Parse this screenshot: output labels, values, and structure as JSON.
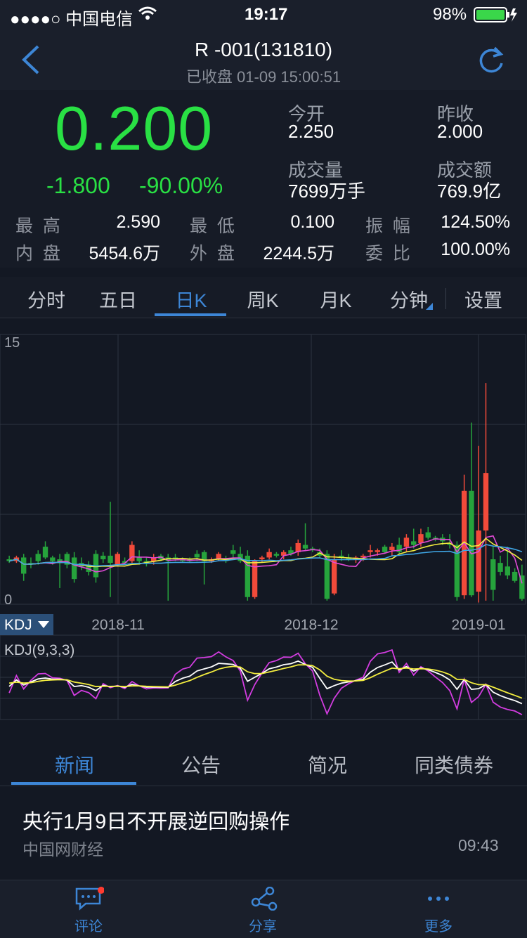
{
  "status_bar": {
    "carrier": "●●●●○ 中国电信",
    "time": "19:17",
    "battery": "98%"
  },
  "header": {
    "title": "R -001(131810)",
    "subtitle": "已收盘   01-09 15:00:51"
  },
  "quote": {
    "price": "0.200",
    "change": "-1.800",
    "change_pct": "-90.00%",
    "open_label": "今开",
    "open": "2.250",
    "prev_close_label": "昨收",
    "prev_close": "2.000",
    "volume_label": "成交量",
    "volume": "7699万手",
    "amount_label": "成交额",
    "amount": "769.9亿",
    "grid": [
      {
        "label": "最  高",
        "value": "2.590"
      },
      {
        "label": "最  低",
        "value": "0.100"
      },
      {
        "label": "振  幅",
        "value": "124.50%"
      },
      {
        "label": "内  盘",
        "value": "5454.6万"
      },
      {
        "label": "外  盘",
        "value": "2244.5万"
      },
      {
        "label": "委  比",
        "value": "100.00%"
      }
    ]
  },
  "chart_tabs": [
    "分时",
    "五日",
    "日K",
    "周K",
    "月K",
    "分钟",
    "设置"
  ],
  "active_chart_tab": "日K",
  "kline": {
    "y_top": "15",
    "y_bottom": "0",
    "x_labels": [
      "2018-11",
      "2018-12",
      "2019-01"
    ],
    "indicator_button": "KDJ",
    "indicator_params": "KDJ(9,3,3)"
  },
  "colors": {
    "up": "#f24a3a",
    "down": "#26a33c",
    "price_green": "#29e044",
    "accent": "#3d86d6"
  },
  "chart_data": {
    "type": "candlestick",
    "ylim": [
      0,
      15
    ],
    "x_ticks": [
      "2018-11",
      "2018-12",
      "2019-01"
    ],
    "candles": [
      {
        "o": 2.5,
        "h": 2.7,
        "l": 2.3,
        "c": 2.4
      },
      {
        "o": 2.4,
        "h": 2.7,
        "l": 2.3,
        "c": 2.6
      },
      {
        "o": 2.6,
        "h": 2.8,
        "l": 1.3,
        "c": 1.7
      },
      {
        "o": 2.3,
        "h": 2.6,
        "l": 2.0,
        "c": 2.2
      },
      {
        "o": 2.8,
        "h": 3.0,
        "l": 2.2,
        "c": 2.4
      },
      {
        "o": 3.2,
        "h": 3.5,
        "l": 2.5,
        "c": 2.6
      },
      {
        "o": 2.6,
        "h": 2.7,
        "l": 2.2,
        "c": 2.4
      },
      {
        "o": 2.5,
        "h": 2.8,
        "l": 0.9,
        "c": 2.3
      },
      {
        "o": 2.8,
        "h": 2.9,
        "l": 2.0,
        "c": 2.2
      },
      {
        "o": 2.6,
        "h": 2.9,
        "l": 1.2,
        "c": 1.4
      },
      {
        "o": 2.3,
        "h": 2.6,
        "l": 1.9,
        "c": 2.1
      },
      {
        "o": 2.2,
        "h": 2.4,
        "l": 1.6,
        "c": 1.8
      },
      {
        "o": 2.8,
        "h": 3.0,
        "l": 1.2,
        "c": 1.5
      },
      {
        "o": 2.7,
        "h": 2.9,
        "l": 2.3,
        "c": 2.5
      },
      {
        "o": 2.7,
        "h": 5.7,
        "l": 0.4,
        "c": 2.3
      },
      {
        "o": 2.2,
        "h": 2.9,
        "l": 2.1,
        "c": 2.8
      },
      {
        "o": 2.4,
        "h": 2.6,
        "l": 2.2,
        "c": 2.3
      },
      {
        "o": 2.4,
        "h": 3.5,
        "l": 2.3,
        "c": 3.3
      },
      {
        "o": 2.6,
        "h": 3.0,
        "l": 2.2,
        "c": 2.4
      },
      {
        "o": 2.4,
        "h": 2.6,
        "l": 2.1,
        "c": 2.3
      },
      {
        "o": 2.4,
        "h": 2.8,
        "l": 2.2,
        "c": 2.6
      },
      {
        "o": 2.7,
        "h": 2.8,
        "l": 2.4,
        "c": 2.5
      },
      {
        "o": 2.6,
        "h": 2.8,
        "l": 0.2,
        "c": 2.4
      },
      {
        "o": 2.6,
        "h": 2.8,
        "l": 2.4,
        "c": 2.5
      },
      {
        "o": 2.5,
        "h": 2.6,
        "l": 2.3,
        "c": 2.4
      },
      {
        "o": 2.5,
        "h": 2.6,
        "l": 2.3,
        "c": 2.4
      },
      {
        "o": 2.8,
        "h": 3.0,
        "l": 2.4,
        "c": 2.6
      },
      {
        "o": 2.9,
        "h": 3.0,
        "l": 1.1,
        "c": 2.4
      },
      {
        "o": 2.4,
        "h": 2.6,
        "l": 2.3,
        "c": 2.5
      },
      {
        "o": 2.5,
        "h": 2.9,
        "l": 2.4,
        "c": 2.8
      },
      {
        "o": 2.5,
        "h": 2.7,
        "l": 2.3,
        "c": 2.4
      },
      {
        "o": 3.0,
        "h": 3.3,
        "l": 2.6,
        "c": 2.8
      },
      {
        "o": 2.8,
        "h": 3.2,
        "l": 2.3,
        "c": 2.4
      },
      {
        "o": 2.7,
        "h": 3.0,
        "l": 0.2,
        "c": 0.4
      },
      {
        "o": 0.4,
        "h": 2.5,
        "l": 0.3,
        "c": 2.4
      },
      {
        "o": 2.5,
        "h": 2.7,
        "l": 2.3,
        "c": 2.6
      },
      {
        "o": 2.6,
        "h": 3.1,
        "l": 2.5,
        "c": 2.9
      },
      {
        "o": 2.8,
        "h": 2.9,
        "l": 2.6,
        "c": 2.7
      },
      {
        "o": 2.7,
        "h": 3.0,
        "l": 2.5,
        "c": 2.9
      },
      {
        "o": 3.0,
        "h": 3.2,
        "l": 2.7,
        "c": 2.8
      },
      {
        "o": 2.9,
        "h": 3.6,
        "l": 2.7,
        "c": 3.4
      },
      {
        "o": 3.3,
        "h": 4.5,
        "l": 3.0,
        "c": 3.1
      },
      {
        "o": 3.1,
        "h": 3.2,
        "l": 2.9,
        "c": 3.0
      },
      {
        "o": 2.9,
        "h": 3.1,
        "l": 2.6,
        "c": 2.7
      },
      {
        "o": 2.8,
        "h": 3.0,
        "l": 0.2,
        "c": 0.3
      },
      {
        "o": 0.6,
        "h": 2.8,
        "l": 0.5,
        "c": 2.5
      },
      {
        "o": 2.7,
        "h": 3.0,
        "l": 2.4,
        "c": 2.6
      },
      {
        "o": 2.6,
        "h": 2.8,
        "l": 2.4,
        "c": 2.5
      },
      {
        "o": 2.5,
        "h": 2.7,
        "l": 2.3,
        "c": 2.6
      },
      {
        "o": 2.6,
        "h": 2.8,
        "l": 2.4,
        "c": 2.7
      },
      {
        "o": 2.9,
        "h": 3.3,
        "l": 2.6,
        "c": 3.0
      },
      {
        "o": 2.9,
        "h": 3.1,
        "l": 2.7,
        "c": 3.0
      },
      {
        "o": 3.2,
        "h": 3.3,
        "l": 2.8,
        "c": 2.9
      },
      {
        "o": 3.0,
        "h": 3.4,
        "l": 2.7,
        "c": 3.2
      },
      {
        "o": 3.3,
        "h": 3.7,
        "l": 2.8,
        "c": 2.9
      },
      {
        "o": 3.2,
        "h": 3.9,
        "l": 2.9,
        "c": 3.7
      },
      {
        "o": 3.5,
        "h": 4.2,
        "l": 3.1,
        "c": 3.3
      },
      {
        "o": 3.4,
        "h": 4.2,
        "l": 3.2,
        "c": 3.9
      },
      {
        "o": 4.0,
        "h": 4.3,
        "l": 3.6,
        "c": 3.7
      },
      {
        "o": 3.7,
        "h": 3.8,
        "l": 3.5,
        "c": 3.6
      },
      {
        "o": 3.7,
        "h": 3.9,
        "l": 3.3,
        "c": 3.5
      },
      {
        "o": 3.4,
        "h": 3.9,
        "l": 3.1,
        "c": 3.3
      },
      {
        "o": 3.3,
        "h": 3.5,
        "l": 0.2,
        "c": 0.4
      },
      {
        "o": 0.5,
        "h": 7.2,
        "l": 0.3,
        "c": 6.3
      },
      {
        "o": 6.3,
        "h": 10.1,
        "l": 0.4,
        "c": 0.5
      },
      {
        "o": 0.7,
        "h": 8.8,
        "l": 0.1,
        "c": 4.1
      },
      {
        "o": 4.1,
        "h": 12.3,
        "l": 0.2,
        "c": 7.3
      },
      {
        "o": 2.5,
        "h": 3.2,
        "l": 0.2,
        "c": 0.8
      },
      {
        "o": 2.3,
        "h": 2.7,
        "l": 1.6,
        "c": 1.8
      },
      {
        "o": 2.1,
        "h": 3.2,
        "l": 1.4,
        "c": 1.6
      },
      {
        "o": 1.8,
        "h": 2.0,
        "l": 1.2,
        "c": 1.3
      },
      {
        "o": 1.6,
        "h": 2.2,
        "l": 0.2,
        "c": 0.3
      }
    ],
    "ma": [
      {
        "name": "MA5",
        "color": "#e04ad6"
      },
      {
        "name": "MA10",
        "color": "#f3ed3f"
      },
      {
        "name": "MA20",
        "color": "#3fa6e5"
      }
    ]
  }
}
